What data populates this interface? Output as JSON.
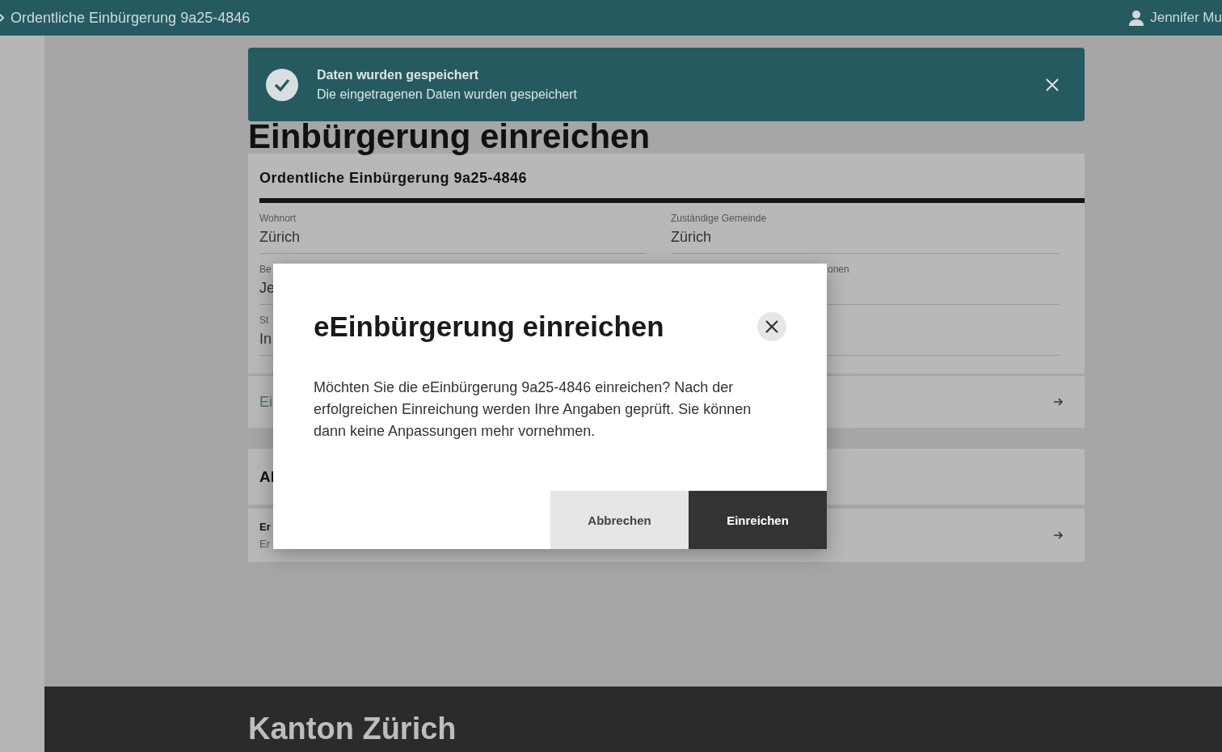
{
  "top_bar": {
    "breadcrumb": "Ordentliche Einbürgerung 9a25-4846",
    "user": "Jennifer Mu"
  },
  "toast": {
    "title": "Daten wurden gespeichert",
    "message": "Die eingetragenen Daten wurden gespeichert"
  },
  "page": {
    "heading": "Einbürgerung einreichen",
    "card": {
      "title": "Ordentliche Einbürgerung 9a25-4846",
      "rows": [
        [
          {
            "label": "Wohnort",
            "value": "Zürich"
          },
          {
            "label": "Zuständige Gemeinde",
            "value": "Zürich"
          }
        ],
        [
          {
            "label": "Be",
            "value": "Je"
          },
          {
            "label": "onen",
            "covered": true
          }
        ],
        [
          {
            "label": "St",
            "value": "In"
          }
        ]
      ]
    },
    "link_row": {
      "label": "Ei"
    },
    "section": {
      "title": "Al"
    },
    "item_row": {
      "title": "Er",
      "subtitle": "Er"
    }
  },
  "modal": {
    "title": "eEinbürgerung einreichen",
    "text": "Möchten Sie die eEinbürgerung 9a25-4846 einreichen? Nach der erfolgreichen Einreichung werden Ihre Angaben geprüft. Sie können dann keine Anpassungen mehr vornehmen.",
    "buttons": [
      {
        "label": "Abbrechen",
        "kind": "secondary"
      },
      {
        "label": "Einreichen",
        "kind": "primary"
      }
    ]
  },
  "footer": {
    "title": "Kanton Zürich"
  }
}
